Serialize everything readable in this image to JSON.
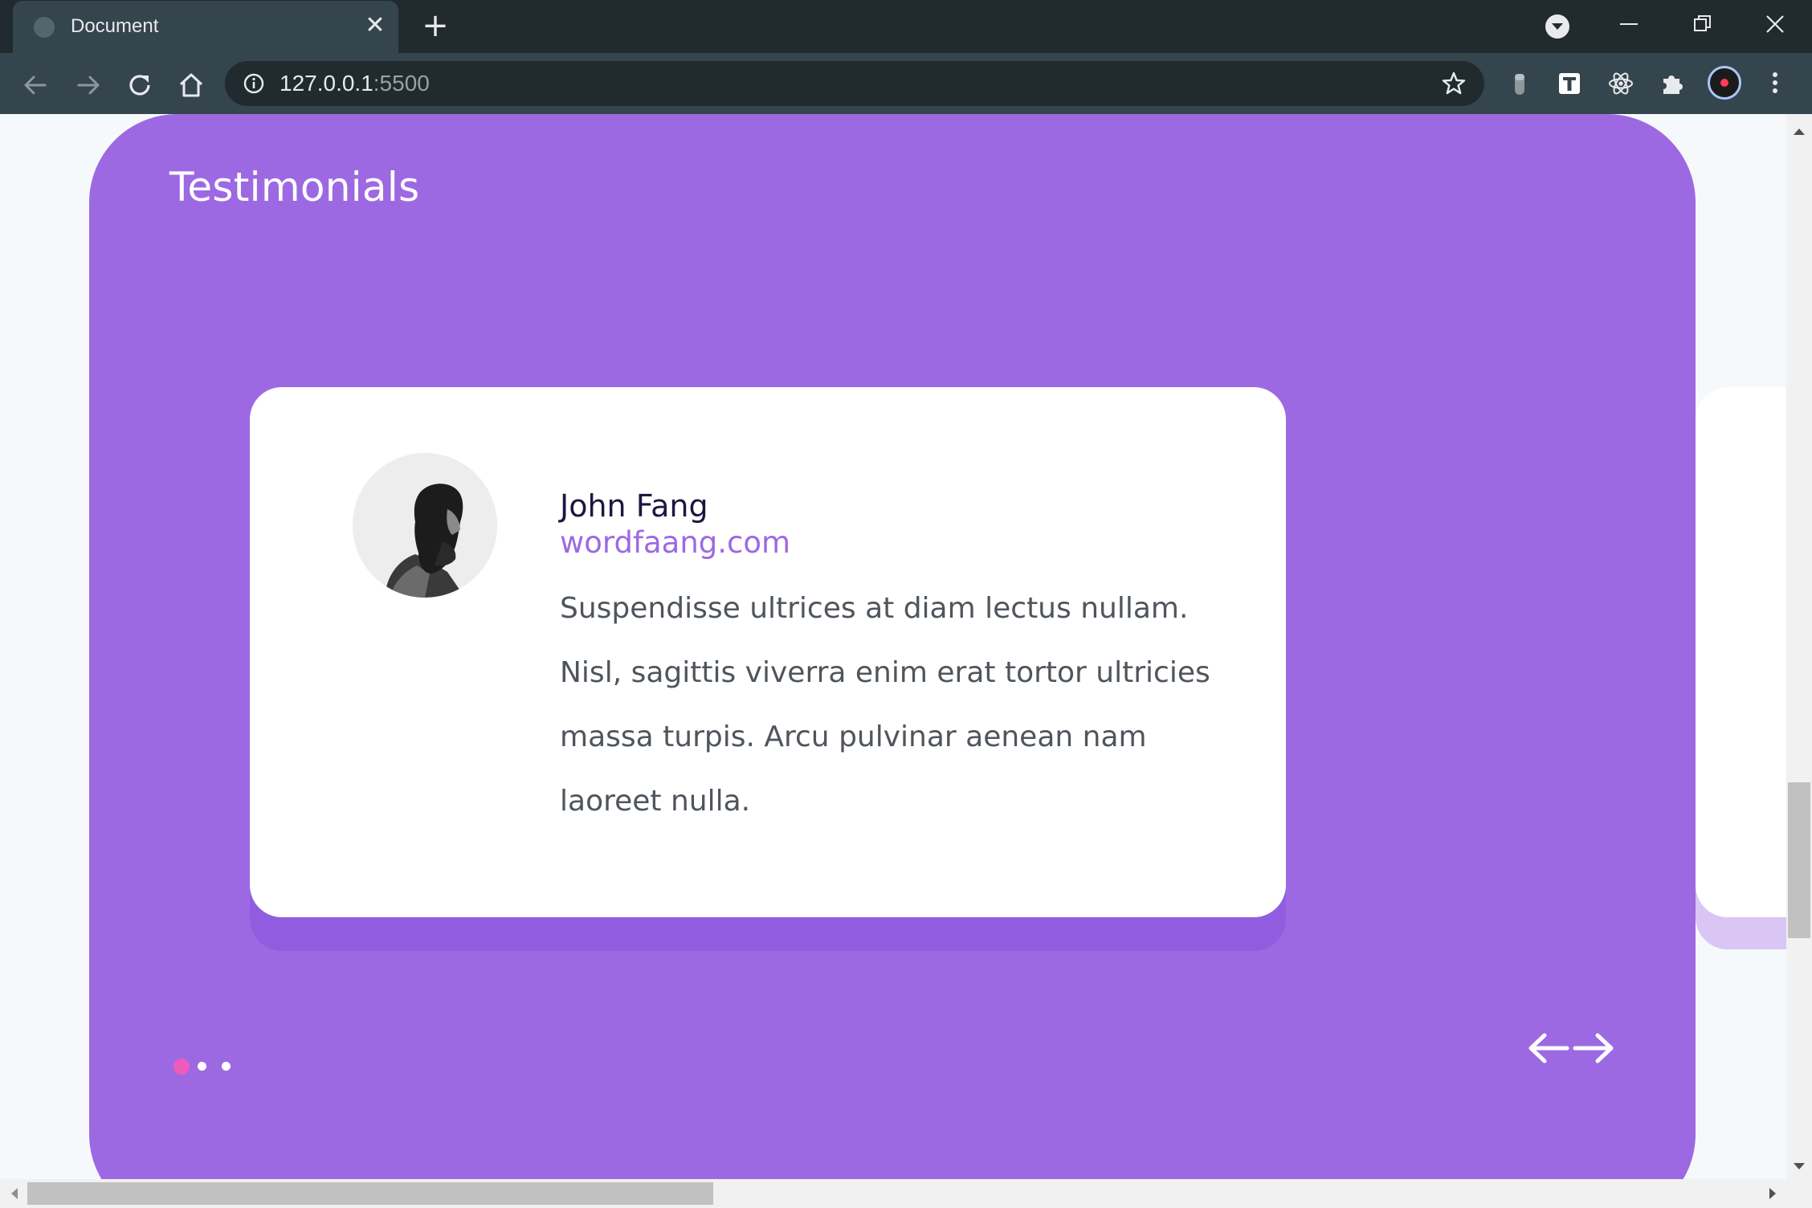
{
  "browser": {
    "tab_title": "Document",
    "tab_close": "✕",
    "new_tab": "+",
    "url_host": "127.0.0.1",
    "url_port": ":5500"
  },
  "page": {
    "section_title": "Testimonials",
    "testimonial": {
      "name": "John Fang",
      "website": "wordfaang.com",
      "quote": "Suspendisse ultrices at diam lectus nullam. Nisl, sagittis viverra enim erat tortor ultricies massa turpis. Arcu pulvinar aenean nam laoreet nulla."
    },
    "pagination": {
      "total": 3,
      "active": 1
    },
    "colors": {
      "section_background": "#9d69e2",
      "active_dot": "#f05bbb",
      "name_text": "#1d1640",
      "link_text": "#9d69e2",
      "quote_text": "#4f555c"
    }
  },
  "icons": {
    "back": "arrow-left-icon",
    "forward": "arrow-right-icon",
    "reload": "reload-icon",
    "home": "home-icon",
    "bookmark": "star-icon",
    "extensions": [
      "lock-extension-icon",
      "t-extension-icon",
      "react-devtools-icon",
      "puzzle-icon"
    ]
  }
}
